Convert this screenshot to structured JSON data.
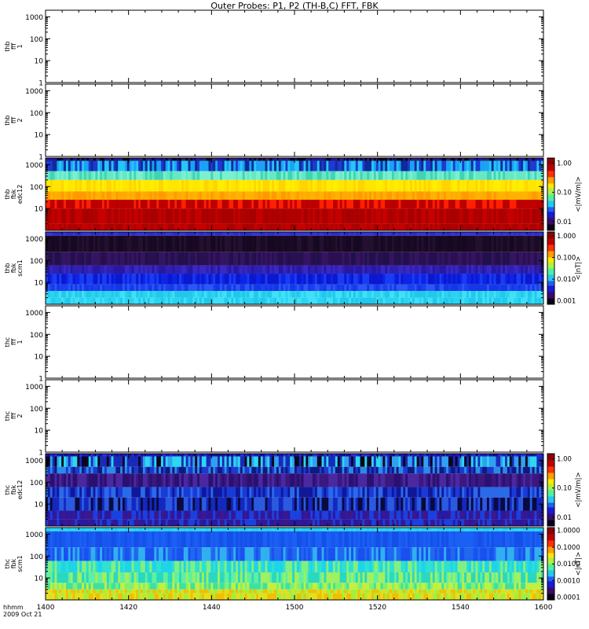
{
  "chart_data": {
    "type": "heatmap",
    "title": "Outer Probes: P1, P2 (TH-B,C) FFT, FBK",
    "xaxis": {
      "tick_labels": [
        "1400",
        "1420",
        "1440",
        "1500",
        "1520",
        "1540",
        "1600"
      ],
      "label_line1": "hhmm",
      "label_line2": "2009 Oct 21"
    },
    "yaxis": {
      "scale": "log",
      "range": [
        1,
        2000
      ],
      "tick_values": [
        1,
        10,
        100,
        1000
      ],
      "tick_labels": [
        "1",
        "10",
        "100",
        "1000"
      ]
    },
    "panels": [
      {
        "id": "thb-fff1",
        "ylabel_lines": [
          "thb",
          "fff",
          "1"
        ],
        "has_data": false,
        "show_tick_1": true
      },
      {
        "id": "thb-fff2",
        "ylabel_lines": [
          "thb",
          "fff",
          "2"
        ],
        "has_data": false,
        "show_tick_1": true
      },
      {
        "id": "thb-fbk-edc12",
        "ylabel_lines": [
          "thb",
          "fbk",
          "edc12"
        ],
        "has_data": true,
        "show_tick_1": false,
        "colorbar": {
          "label": "<|mV/m|>",
          "tick_labels": [
            "1.00",
            "0.10",
            "0.01"
          ],
          "tick_values": [
            1.0,
            0.1,
            0.01
          ],
          "range": [
            0.005,
            1.5
          ]
        },
        "bands": [
          {
            "fmin": 1500,
            "fmax": 2000,
            "palette": [
              "#0b0018",
              "#3a1b78",
              "#1d14a8"
            ]
          },
          {
            "fmin": 500,
            "fmax": 1500,
            "palette": [
              "#1aa3f5",
              "#1e3ad0",
              "#25c7f7",
              "#0b2c9a"
            ]
          },
          {
            "fmin": 200,
            "fmax": 500,
            "palette": [
              "#66e8c5",
              "#3fd4b5",
              "#7af0d0"
            ]
          },
          {
            "fmin": 60,
            "fmax": 200,
            "palette": [
              "#ffee00",
              "#ffd400",
              "#ffe500"
            ]
          },
          {
            "fmin": 25,
            "fmax": 60,
            "palette": [
              "#ffaa00",
              "#ff9a00",
              "#ffb300"
            ]
          },
          {
            "fmin": 10,
            "fmax": 25,
            "palette": [
              "#c00000",
              "#ff2000",
              "#b80000"
            ]
          },
          {
            "fmin": 2,
            "fmax": 10,
            "palette": [
              "#b00000",
              "#c50000",
              "#a80000"
            ]
          }
        ]
      },
      {
        "id": "thb-fbk-scm1",
        "ylabel_lines": [
          "thb",
          "fbk",
          "scm1"
        ],
        "has_data": true,
        "show_tick_1": false,
        "colorbar": {
          "label": "<|nT|>",
          "tick_labels": [
            "1.000",
            "0.100",
            "0.010",
            "0.001"
          ],
          "tick_values": [
            1.0,
            0.1,
            0.01,
            0.001
          ],
          "range": [
            0.0007,
            1.5
          ]
        },
        "bands": [
          {
            "fmin": 1350,
            "fmax": 2000,
            "palette": [
              "#2a2ad0",
              "#3434dc"
            ]
          },
          {
            "fmin": 250,
            "fmax": 1350,
            "palette": [
              "#1a0a24",
              "#24102f",
              "#160820"
            ]
          },
          {
            "fmin": 60,
            "fmax": 250,
            "palette": [
              "#2a1050",
              "#351560",
              "#22104a"
            ]
          },
          {
            "fmin": 25,
            "fmax": 60,
            "palette": [
              "#3020b0",
              "#2818a0",
              "#3a28c0"
            ]
          },
          {
            "fmin": 8,
            "fmax": 25,
            "palette": [
              "#0d24e6",
              "#1a3cf0",
              "#0a18d0"
            ]
          },
          {
            "fmin": 4,
            "fmax": 8,
            "palette": [
              "#1c40f0",
              "#2a58f4",
              "#1238e8"
            ]
          },
          {
            "fmin": 2,
            "fmax": 4,
            "palette": [
              "#2ad4f0",
              "#20c8ea",
              "#40e0f8"
            ]
          }
        ]
      },
      {
        "id": "thc-fff1",
        "ylabel_lines": [
          "thc",
          "fff",
          "1"
        ],
        "has_data": false,
        "show_tick_1": true
      },
      {
        "id": "thc-fff2",
        "ylabel_lines": [
          "thc",
          "fff",
          "2"
        ],
        "has_data": false,
        "show_tick_1": true
      },
      {
        "id": "thc-fbk-edc12",
        "ylabel_lines": [
          "thc",
          "fbk",
          "edc12"
        ],
        "has_data": true,
        "show_tick_1": false,
        "colorbar": {
          "label": "<|mV/m|>",
          "tick_labels": [
            "1.00",
            "0.10",
            "0.01"
          ],
          "tick_values": [
            1.0,
            0.1,
            0.01
          ],
          "range": [
            0.005,
            1.5
          ]
        },
        "bands": [
          {
            "fmin": 1500,
            "fmax": 2000,
            "palette": [
              "#1d14c8",
              "#2430d8",
              "#141090"
            ]
          },
          {
            "fmin": 500,
            "fmax": 1500,
            "palette": [
              "#0a0620",
              "#30a0f0",
              "#1a2ab8",
              "#2ad8f0"
            ]
          },
          {
            "fmin": 250,
            "fmax": 500,
            "palette": [
              "#1a3ad0",
              "#2a8ae8",
              "#0e1a80"
            ]
          },
          {
            "fmin": 60,
            "fmax": 250,
            "palette": [
              "#3a1880",
              "#2a1070",
              "#4a28a0"
            ]
          },
          {
            "fmin": 20,
            "fmax": 60,
            "palette": [
              "#1a3ad8",
              "#2a6ae8",
              "#101898"
            ]
          },
          {
            "fmin": 5,
            "fmax": 20,
            "palette": [
              "#1428c0",
              "#0a0a40",
              "#2a5ae0"
            ]
          },
          {
            "fmin": 2,
            "fmax": 5,
            "palette": [
              "#2a18a0",
              "#1a40e0",
              "#3a1890"
            ]
          }
        ]
      },
      {
        "id": "thc-fbk-scm1",
        "ylabel_lines": [
          "thc",
          "fbk",
          "scm1"
        ],
        "has_data": true,
        "show_tick_1": false,
        "colorbar": {
          "label": "<|nT|>",
          "tick_labels": [
            "1.0000",
            "0.1000",
            "0.0100",
            "0.0010",
            "0.0001"
          ],
          "tick_values": [
            1.0,
            0.1,
            0.01,
            0.001,
            0.0001
          ],
          "range": [
            7e-05,
            1.5
          ]
        },
        "bands": [
          {
            "fmin": 1350,
            "fmax": 2000,
            "palette": [
              "#20d0f0",
              "#2ad8f4"
            ]
          },
          {
            "fmin": 250,
            "fmax": 1350,
            "palette": [
              "#1858f0",
              "#1a60f4",
              "#1450e8"
            ]
          },
          {
            "fmin": 60,
            "fmax": 250,
            "palette": [
              "#1a50f0",
              "#2068f0",
              "#30b0f0"
            ]
          },
          {
            "fmin": 18,
            "fmax": 60,
            "palette": [
              "#20d4e8",
              "#30e0d0",
              "#80f080"
            ]
          },
          {
            "fmin": 6,
            "fmax": 18,
            "palette": [
              "#2ad8c0",
              "#60f0a0",
              "#a0f060"
            ]
          },
          {
            "fmin": 3,
            "fmax": 6,
            "palette": [
              "#40e0a0",
              "#80f070",
              "#c0f040"
            ]
          },
          {
            "fmin": 2,
            "fmax": 3,
            "palette": [
              "#a0f040",
              "#e0e020",
              "#f0c000"
            ]
          }
        ]
      }
    ]
  }
}
